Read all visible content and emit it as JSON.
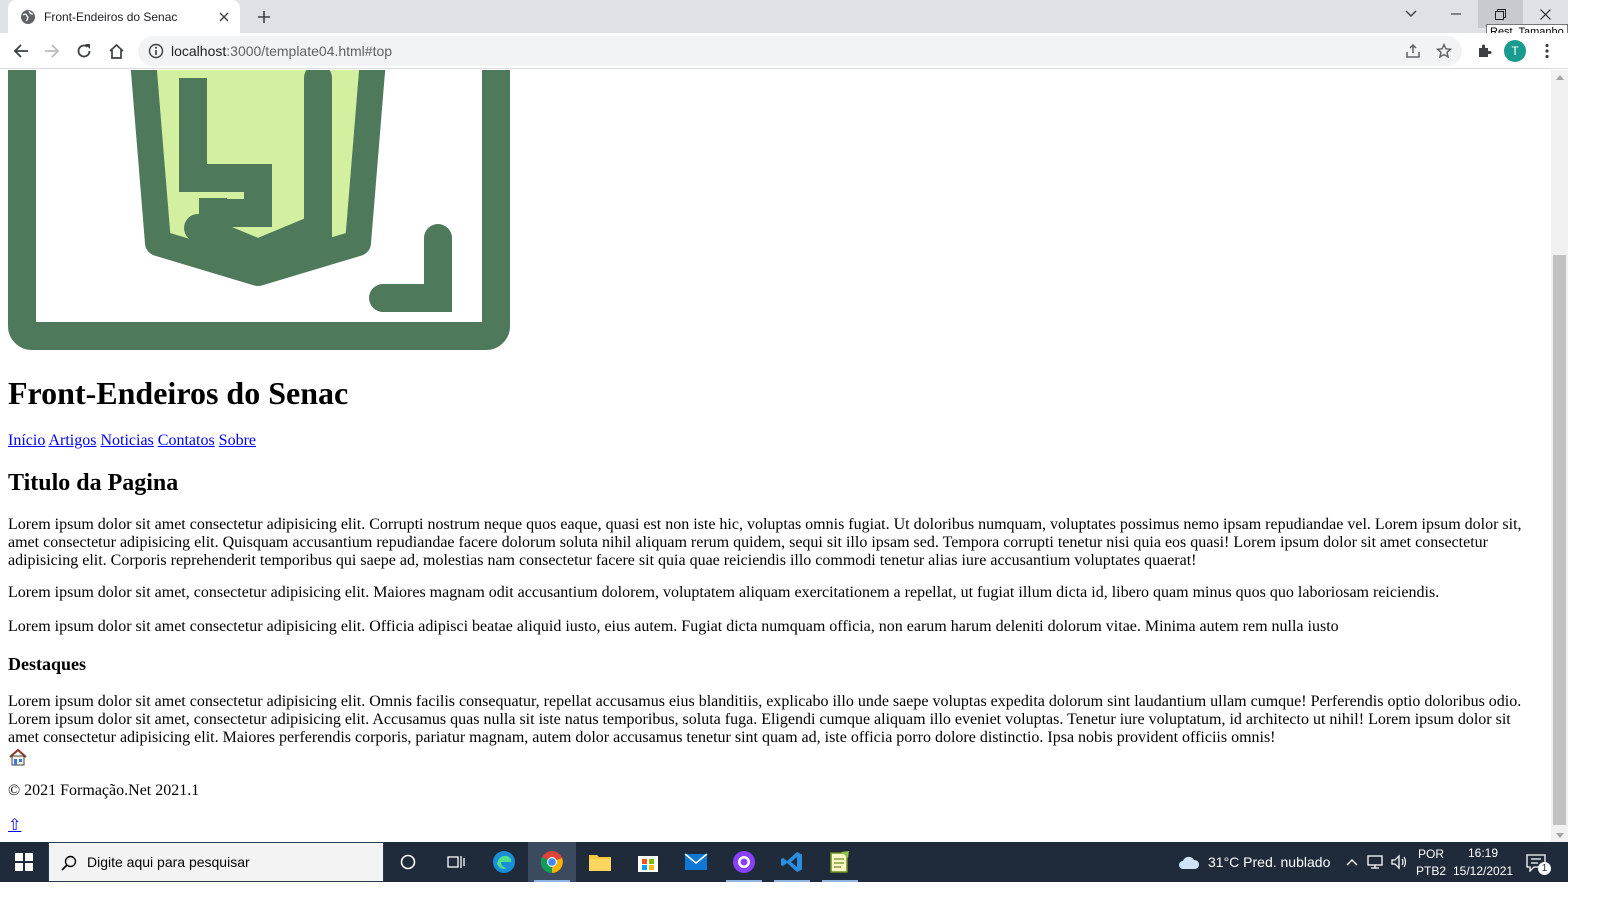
{
  "browser": {
    "tab_title": "Front-Endeiros do Senac",
    "url_host": "localhost",
    "url_rest": ":3000/template04.html#top",
    "tooltip": "Rest. Tamanho",
    "profile_initial": "T"
  },
  "page": {
    "site_title": "Front-Endeiros do Senac",
    "nav": [
      "Início",
      "Artigos",
      "Noticias",
      "Contatos",
      "Sobre"
    ],
    "page_title": "Titulo da Pagina",
    "paragraphs": [
      "Lorem ipsum dolor sit amet consectetur adipisicing elit. Corrupti nostrum neque quos eaque, quasi est non iste hic, voluptas omnis fugiat. Ut doloribus numquam, voluptates possimus nemo ipsam repudiandae vel. Lorem ipsum dolor sit, amet consectetur adipisicing elit. Quisquam accusantium repudiandae facere dolorum soluta nihil aliquam rerum quidem, sequi sit illo ipsam sed. Tempora corrupti tenetur nisi quia eos quasi! Lorem ipsum dolor sit amet consectetur adipisicing elit. Corporis reprehenderit temporibus qui saepe ad, molestias nam consectetur facere sit quia quae reiciendis illo commodi tenetur alias iure accusantium voluptates quaerat!",
      "Lorem ipsum dolor sit amet, consectetur adipisicing elit. Maiores magnam odit accusantium dolorem, voluptatem aliquam exercitationem a repellat, ut fugiat illum dicta id, libero quam minus quos quo laboriosam reiciendis.",
      "Lorem ipsum dolor sit amet consectetur adipisicing elit. Officia adipisci beatae aliquid iusto, eius autem. Fugiat dicta numquam officia, non earum harum deleniti dolorum vitae. Minima autem rem nulla iusto"
    ],
    "highlights_title": "Destaques",
    "highlights_text": "Lorem ipsum dolor sit amet consectetur adipisicing elit. Omnis facilis consequatur, repellat accusamus eius blanditiis, explicabo illo unde saepe voluptas expedita dolorum sint laudantium ullam cumque! Perferendis optio doloribus odio. Lorem ipsum dolor sit amet, consectetur adipisicing elit. Accusamus quas nulla sit iste natus temporibus, soluta fuga. Eligendi cumque aliquam illo eveniet voluptas. Tenetur iure voluptatum, id architecto ut nihil! Lorem ipsum dolor sit amet consectetur adipisicing elit. Maiores perferendis corporis, pariatur magnam, autem dolor accusamus tenetur sint quam ad, iste officia porro dolore distinctio. Ipsa nobis provident officiis omnis!",
    "footer": "© 2021 Formação.Net 2021.1",
    "top_link": "⇧",
    "logo_colors": {
      "frame": "#4e7a5b",
      "fill": "#d2f0a0"
    }
  },
  "taskbar": {
    "search_placeholder": "Digite aqui para pesquisar",
    "weather": "31°C  Pred. nublado",
    "lang_top": "POR",
    "lang_bottom": "PTB2",
    "time": "16:19",
    "date": "15/12/2021",
    "notifications": "1"
  }
}
